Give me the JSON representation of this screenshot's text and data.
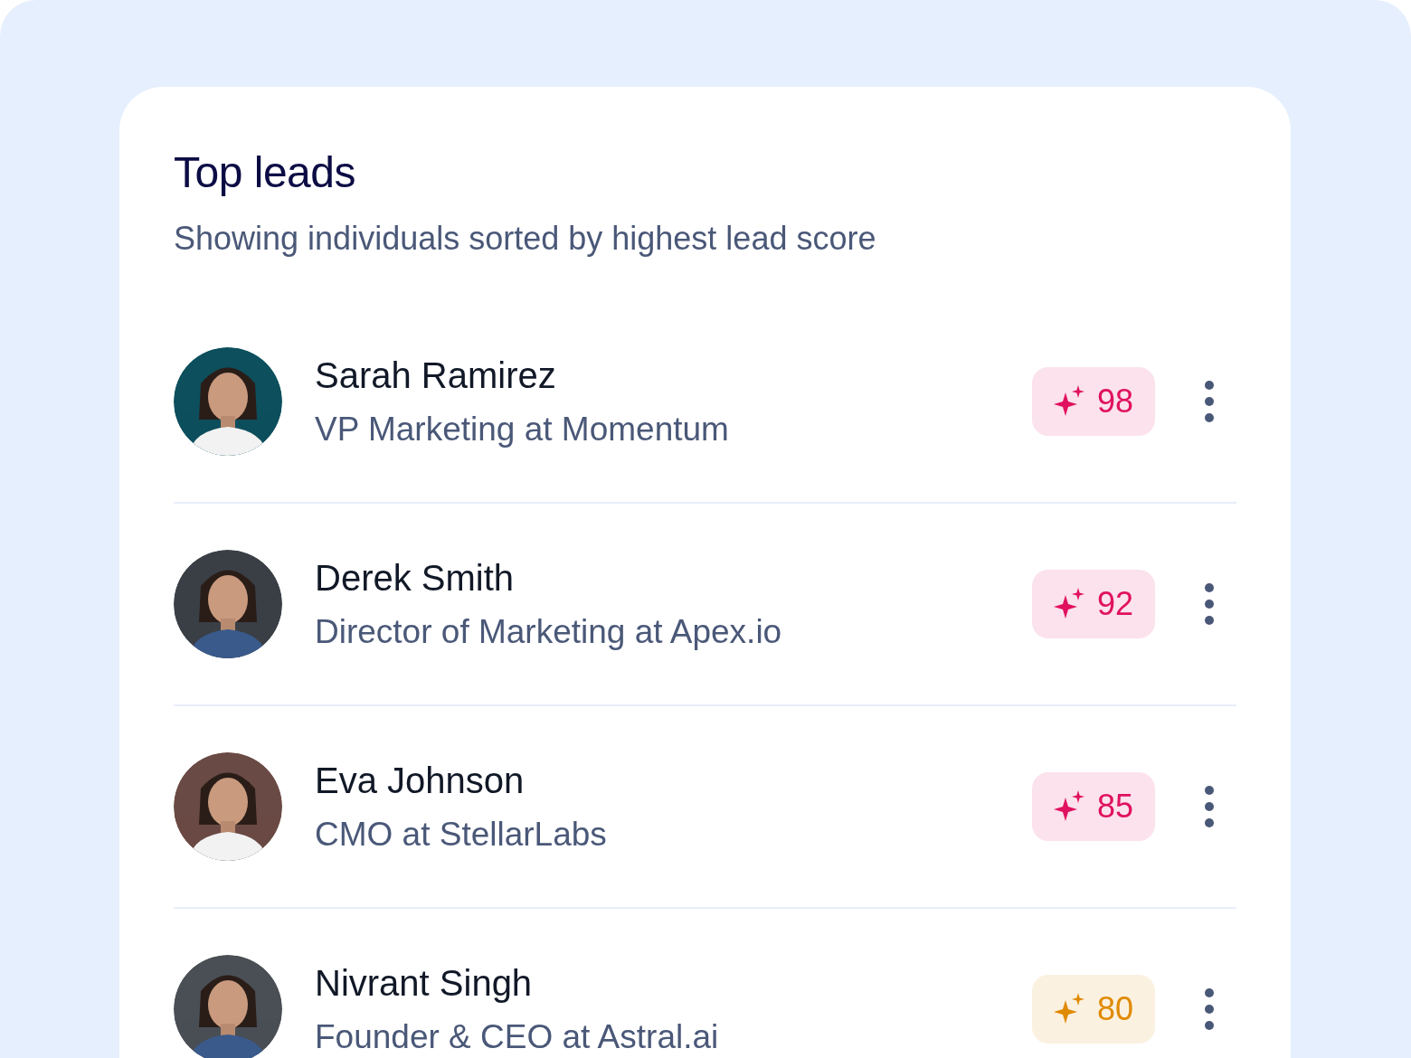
{
  "card": {
    "title": "Top leads",
    "subtitle": "Showing individuals sorted by highest lead score"
  },
  "leads": [
    {
      "kind": "picture",
      "name": "Sarah Ramirez",
      "role": "VP Marketing at Momentum",
      "score": "98",
      "color": "#e0115f"
    },
    {
      "kind": "picture",
      "name": "Derek Smith",
      "role": "Director of Marketing at Apex.io",
      "score": "92",
      "color": "#e0115f"
    },
    {
      "kind": "picture",
      "name": "Eva Johnson",
      "role": "CMO at StellarLabs",
      "score": "85",
      "color": "#e0115f"
    },
    {
      "kind": "picture",
      "name": "Nivrant Singh",
      "role": "Founder & CEO at Astral.ai",
      "score": "80",
      "color": "#e08a00"
    }
  ]
}
